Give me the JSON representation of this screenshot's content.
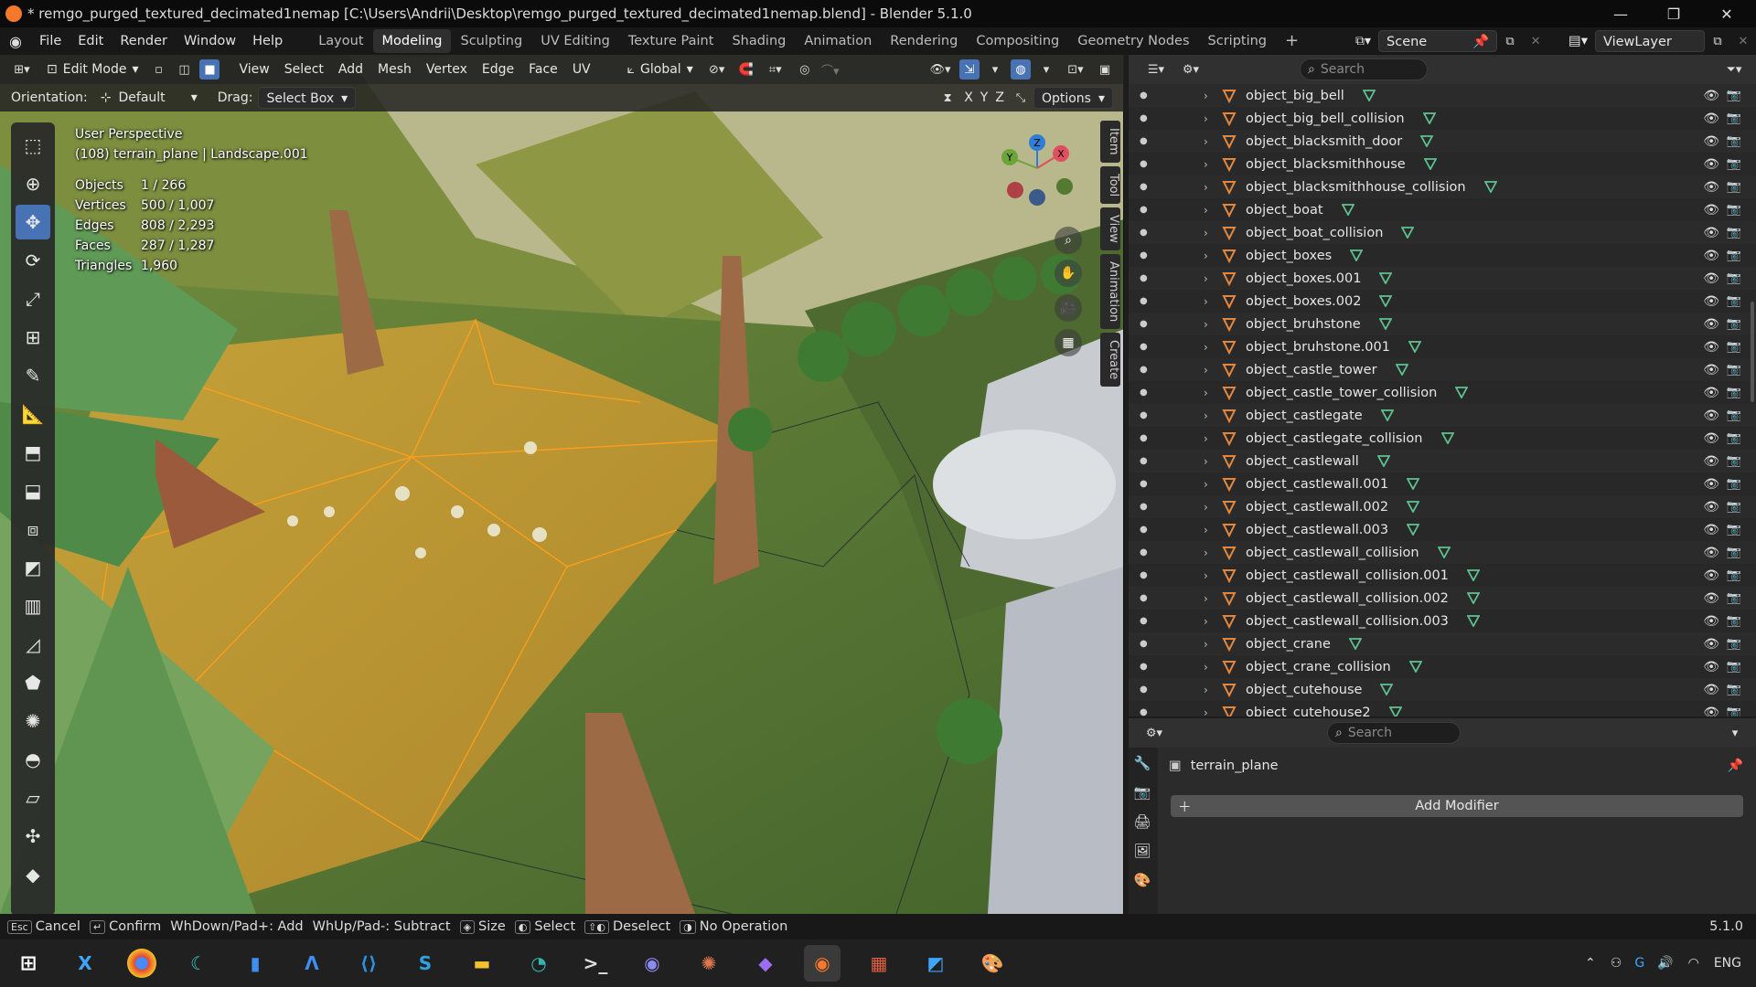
{
  "window": {
    "title": "* remgo_purged_textured_decimated1nemap [C:\\Users\\Andrii\\Desktop\\remgo_purged_textured_decimated1nemap.blend] - Blender 5.1.0"
  },
  "menu": [
    "File",
    "Edit",
    "Render",
    "Window",
    "Help"
  ],
  "workspaces": [
    "Layout",
    "Modeling",
    "Sculpting",
    "UV Editing",
    "Texture Paint",
    "Shading",
    "Animation",
    "Rendering",
    "Compositing",
    "Geometry Nodes",
    "Scripting"
  ],
  "active_workspace": "Modeling",
  "scene": {
    "label": "Scene",
    "viewlayer": "ViewLayer"
  },
  "viewport_header": {
    "mode": "Edit Mode",
    "menus": [
      "View",
      "Select",
      "Add",
      "Mesh",
      "Vertex",
      "Edge",
      "Face",
      "UV"
    ],
    "transform_orientation": "Global",
    "orientation_label": "Orientation:",
    "orientation_value": "Default",
    "drag_label": "Drag:",
    "drag_value": "Select Box",
    "options_label": "Options",
    "axes": [
      "X",
      "Y",
      "Z"
    ]
  },
  "overlay": {
    "perspective": "User Perspective",
    "object_info": "(108) terrain_plane | Landscape.001",
    "stats": [
      {
        "label": "Objects",
        "value": "1 / 266"
      },
      {
        "label": "Vertices",
        "value": "500 / 1,007"
      },
      {
        "label": "Edges",
        "value": "808 / 2,293"
      },
      {
        "label": "Faces",
        "value": "287 / 1,287"
      },
      {
        "label": "Triangles",
        "value": "1,960"
      }
    ]
  },
  "gizmo": {
    "x": "X",
    "y": "Y",
    "z": "Z"
  },
  "npanel_tabs": [
    "Item",
    "Tool",
    "View",
    "Animation",
    "Create"
  ],
  "outliner": {
    "search_placeholder": "Search",
    "items": [
      "object_big_bell",
      "object_big_bell_collision",
      "object_blacksmith_door",
      "object_blacksmithhouse",
      "object_blacksmithhouse_collision",
      "object_boat",
      "object_boat_collision",
      "object_boxes",
      "object_boxes.001",
      "object_boxes.002",
      "object_bruhstone",
      "object_bruhstone.001",
      "object_castle_tower",
      "object_castle_tower_collision",
      "object_castlegate",
      "object_castlegate_collision",
      "object_castlewall",
      "object_castlewall.001",
      "object_castlewall.002",
      "object_castlewall.003",
      "object_castlewall_collision",
      "object_castlewall_collision.001",
      "object_castlewall_collision.002",
      "object_castlewall_collision.003",
      "object_crane",
      "object_crane_collision",
      "object_cutehouse",
      "object_cutehouse2"
    ]
  },
  "properties": {
    "search_placeholder": "Search",
    "object_name": "terrain_plane",
    "add_modifier": "Add Modifier"
  },
  "statusbar": {
    "items": [
      {
        "key": "Esc",
        "label": "Cancel"
      },
      {
        "key": "↵",
        "label": "Confirm"
      },
      {
        "key": "",
        "label": "WhDown/Pad+: Add"
      },
      {
        "key": "",
        "label": "WhUp/Pad-: Subtract"
      },
      {
        "key": "◈",
        "label": "Size"
      },
      {
        "key": "◐",
        "label": "Select"
      },
      {
        "key": "⇧◐",
        "label": "Deselect"
      },
      {
        "key": "◑",
        "label": "No Operation"
      }
    ],
    "version": "5.1.0"
  },
  "taskbar": {
    "tray": {
      "lang": "ENG"
    }
  },
  "colors": {
    "accent": "#4772b3",
    "selection_orange": "#ff9f1a",
    "mesh_icon_orange": "#e2873d",
    "data_icon_green": "#5ec28f"
  }
}
